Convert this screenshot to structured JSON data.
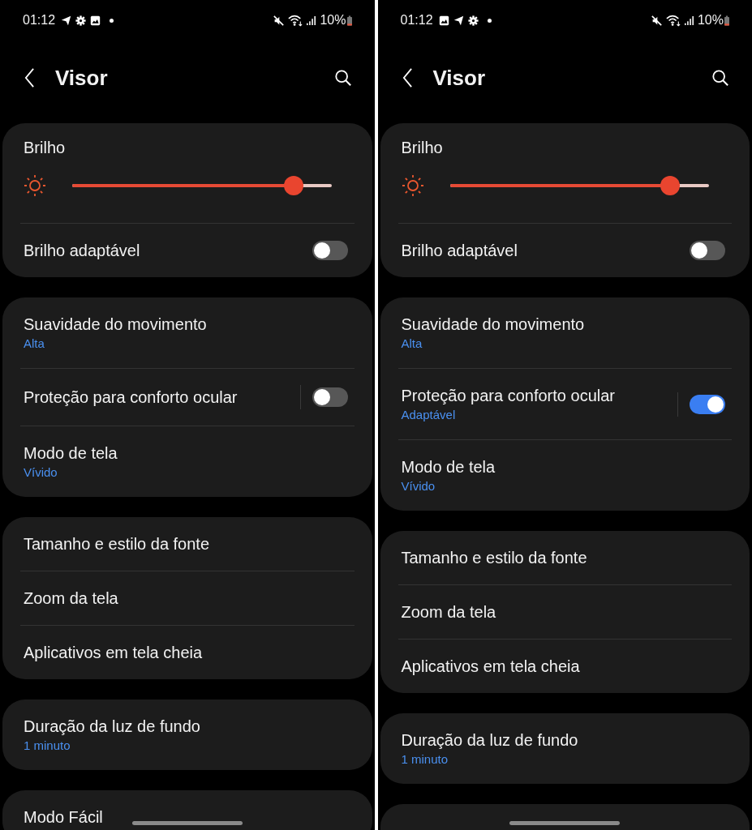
{
  "screens": [
    {
      "status_bar": {
        "time": "01:12",
        "notification_icons": [
          {
            "kind": "send"
          },
          {
            "kind": "settings"
          },
          {
            "kind": "image"
          },
          {
            "kind": "dot"
          }
        ],
        "battery": "10%"
      },
      "title": "Visor",
      "cards": [
        {
          "items": [
            {
              "kind": "slider",
              "label": "Brilho",
              "level": 0.855
            },
            {
              "kind": "toggle",
              "label": "Brilho adaptável",
              "on": false
            }
          ]
        },
        {
          "items": [
            {
              "kind": "link",
              "label": "Suavidade do movimento",
              "sub": "Alta"
            },
            {
              "kind": "toggle_split",
              "label": "Proteção para conforto ocular",
              "on": false
            },
            {
              "kind": "link",
              "label": "Modo de tela",
              "sub": "Vívido"
            }
          ]
        },
        {
          "items": [
            {
              "kind": "link",
              "label": "Tamanho e estilo da fonte"
            },
            {
              "kind": "link",
              "label": "Zoom da tela"
            },
            {
              "kind": "link",
              "label": "Aplicativos em tela cheia"
            }
          ]
        },
        {
          "items": [
            {
              "kind": "link",
              "label": "Duração da luz de fundo",
              "sub": "1 minuto"
            }
          ]
        },
        {
          "items": [
            {
              "kind": "link",
              "label": "Modo Fácil"
            }
          ]
        }
      ]
    },
    {
      "status_bar": {
        "time": "01:12",
        "notification_icons": [
          {
            "kind": "image"
          },
          {
            "kind": "send"
          },
          {
            "kind": "settings"
          },
          {
            "kind": "dot"
          }
        ],
        "battery": "10%"
      },
      "title": "Visor",
      "cards": [
        {
          "items": [
            {
              "kind": "slider",
              "label": "Brilho",
              "level": 0.85
            },
            {
              "kind": "toggle",
              "label": "Brilho adaptável",
              "on": false
            }
          ]
        },
        {
          "items": [
            {
              "kind": "link",
              "label": "Suavidade do movimento",
              "sub": "Alta"
            },
            {
              "kind": "toggle_split",
              "label": "Proteção para conforto ocular",
              "on": true,
              "sub": "Adaptável"
            },
            {
              "kind": "link",
              "label": "Modo de tela",
              "sub": "Vívido"
            }
          ]
        },
        {
          "items": [
            {
              "kind": "link",
              "label": "Tamanho e estilo da fonte"
            },
            {
              "kind": "link",
              "label": "Zoom da tela"
            },
            {
              "kind": "link",
              "label": "Aplicativos em tela cheia"
            }
          ]
        },
        {
          "items": [
            {
              "kind": "link",
              "label": "Duração da luz de fundo",
              "sub": "1 minuto"
            }
          ]
        }
      ],
      "more_below": true
    }
  ]
}
